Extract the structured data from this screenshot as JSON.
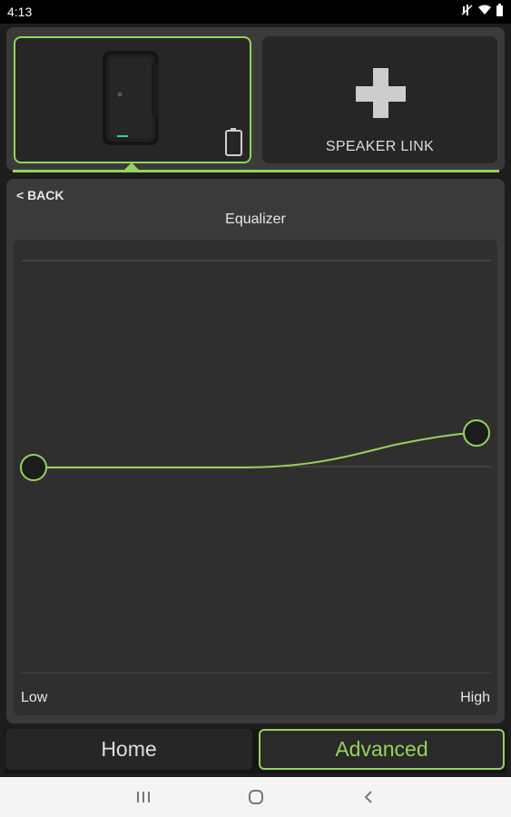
{
  "status_bar": {
    "time": "4:13",
    "icons": [
      "mute-icon",
      "wifi-icon",
      "battery-icon"
    ]
  },
  "speakers": {
    "selected_device": "speaker",
    "link_label": "SPEAKER LINK"
  },
  "equalizer": {
    "back_label": "< BACK",
    "title": "Equalizer",
    "low_label": "Low",
    "high_label": "High",
    "curve_color": "#94d35a"
  },
  "tabs": [
    {
      "label": "Home",
      "active": false
    },
    {
      "label": "Advanced",
      "active": true
    }
  ],
  "colors": {
    "accent": "#94d35a",
    "panel": "#3a3a3a",
    "background": "#1d1d1d"
  }
}
